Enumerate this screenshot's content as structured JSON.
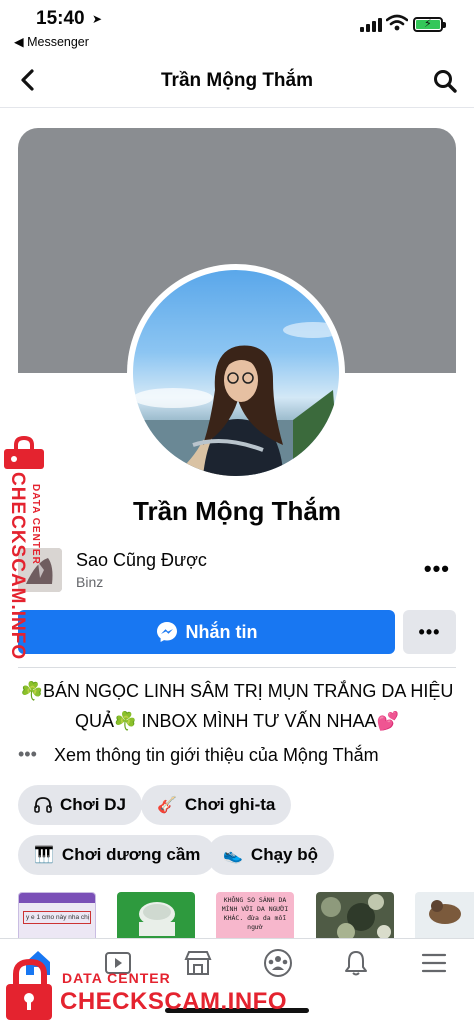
{
  "status_bar": {
    "time": "15:40",
    "back_app": "◀ Messenger"
  },
  "nav": {
    "title": "Trần Mộng Thắm"
  },
  "profile": {
    "name": "Trần Mộng Thắm"
  },
  "music": {
    "title": "Sao Cũng Được",
    "artist": "Binz"
  },
  "actions": {
    "message_label": "Nhắn tin",
    "more_label": "•••"
  },
  "bio": {
    "text": "☘️BÁN NGỌC LINH SÂM TRỊ MỤN TRẮNG DA HIỆU QUẢ☘️ INBOX MÌNH TƯ VẤN NHAA💕",
    "about_dots": "•••",
    "about_text": "Xem thông tin giới thiệu của Mộng Thắm"
  },
  "hobbies": [
    {
      "label": "Chơi DJ",
      "icon": "headphones-icon"
    },
    {
      "label": "Chơi ghi-ta",
      "icon": "guitar-icon"
    },
    {
      "label": "Chơi dương cầm",
      "icon": "piano-icon"
    },
    {
      "label": "Chạy bộ",
      "icon": "running-shoe-icon"
    }
  ],
  "photo_captions": {
    "p1": "y e 1 cmo này nha chị",
    "p3": "KHÔNG SO SÁNH DA MÌNH VỚI DA NGƯỜI KHÁC. đừa da mỗi ngườ"
  },
  "tabs": [
    "home-icon",
    "video-icon",
    "marketplace-icon",
    "groups-icon",
    "notifications-icon",
    "menu-icon"
  ],
  "watermark": {
    "side_main": "CHECKSCAM.INFO",
    "side_sub": "DATA CENTER",
    "bottom_sub": "DATA CENTER",
    "bottom_main": "CHECKSCAM.INFO"
  },
  "colors": {
    "accent": "#1877f2",
    "cover": "#8a8d91",
    "chip_bg": "#e4e6eb",
    "watermark": "#e4232f"
  }
}
